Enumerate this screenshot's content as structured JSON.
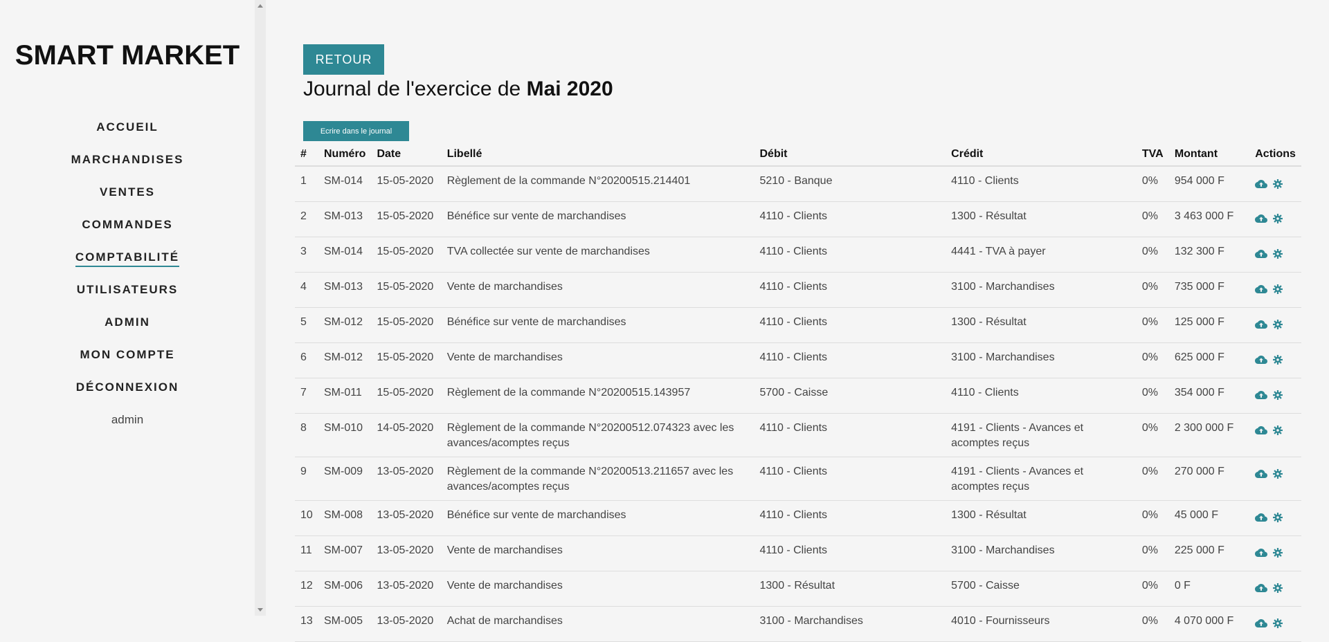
{
  "sidebar": {
    "brand": "SMART MARKET",
    "items": [
      {
        "label": "ACCUEIL",
        "active": false
      },
      {
        "label": "MARCHANDISES",
        "active": false
      },
      {
        "label": "VENTES",
        "active": false
      },
      {
        "label": "COMMANDES",
        "active": false
      },
      {
        "label": "COMPTABILITÉ",
        "active": true
      },
      {
        "label": "UTILISATEURS",
        "active": false
      },
      {
        "label": "ADMIN",
        "active": false
      },
      {
        "label": "MON COMPTE",
        "active": false
      },
      {
        "label": "DÉCONNEXION",
        "active": false
      }
    ],
    "user": "admin"
  },
  "main": {
    "back_label": "RETOUR",
    "title_prefix": "Journal de l'exercice de ",
    "title_period": "Mai 2020",
    "write_label": "Ecrire dans le journal"
  },
  "table": {
    "headers": [
      "#",
      "Numéro",
      "Date",
      "Libellé",
      "Débit",
      "Crédit",
      "TVA",
      "Montant",
      "Actions"
    ],
    "rows": [
      {
        "idx": "1",
        "num": "SM-014",
        "date": "15-05-2020",
        "libelle": "Règlement de la commande N°20200515.214401",
        "debit": "5210 - Banque",
        "credit": "4110 - Clients",
        "tva": "0%",
        "montant": "954 000 F"
      },
      {
        "idx": "2",
        "num": "SM-013",
        "date": "15-05-2020",
        "libelle": "Bénéfice sur vente de marchandises",
        "debit": "4110 - Clients",
        "credit": "1300 - Résultat",
        "tva": "0%",
        "montant": "3 463 000 F"
      },
      {
        "idx": "3",
        "num": "SM-014",
        "date": "15-05-2020",
        "libelle": "TVA collectée sur vente de marchandises",
        "debit": "4110 - Clients",
        "credit": "4441 - TVA à payer",
        "tva": "0%",
        "montant": "132 300 F"
      },
      {
        "idx": "4",
        "num": "SM-013",
        "date": "15-05-2020",
        "libelle": "Vente de marchandises",
        "debit": "4110 - Clients",
        "credit": "3100 - Marchandises",
        "tva": "0%",
        "montant": "735 000 F"
      },
      {
        "idx": "5",
        "num": "SM-012",
        "date": "15-05-2020",
        "libelle": "Bénéfice sur vente de marchandises",
        "debit": "4110 - Clients",
        "credit": "1300 - Résultat",
        "tva": "0%",
        "montant": "125 000 F"
      },
      {
        "idx": "6",
        "num": "SM-012",
        "date": "15-05-2020",
        "libelle": "Vente de marchandises",
        "debit": "4110 - Clients",
        "credit": "3100 - Marchandises",
        "tva": "0%",
        "montant": "625 000 F"
      },
      {
        "idx": "7",
        "num": "SM-011",
        "date": "15-05-2020",
        "libelle": "Règlement de la commande N°20200515.143957",
        "debit": "5700 - Caisse",
        "credit": "4110 - Clients",
        "tva": "0%",
        "montant": "354 000 F"
      },
      {
        "idx": "8",
        "num": "SM-010",
        "date": "14-05-2020",
        "libelle": "Règlement de la commande N°20200512.074323 avec les avances/acomptes reçus",
        "debit": "4110 - Clients",
        "credit": "4191 - Clients - Avances et acomptes reçus",
        "tva": "0%",
        "montant": "2 300 000 F"
      },
      {
        "idx": "9",
        "num": "SM-009",
        "date": "13-05-2020",
        "libelle": "Règlement de la commande N°20200513.211657 avec les avances/acomptes reçus",
        "debit": "4110 - Clients",
        "credit": "4191 - Clients - Avances et acomptes reçus",
        "tva": "0%",
        "montant": "270 000 F"
      },
      {
        "idx": "10",
        "num": "SM-008",
        "date": "13-05-2020",
        "libelle": "Bénéfice sur vente de marchandises",
        "debit": "4110 - Clients",
        "credit": "1300 - Résultat",
        "tva": "0%",
        "montant": "45 000 F"
      },
      {
        "idx": "11",
        "num": "SM-007",
        "date": "13-05-2020",
        "libelle": "Vente de marchandises",
        "debit": "4110 - Clients",
        "credit": "3100 - Marchandises",
        "tva": "0%",
        "montant": "225 000 F"
      },
      {
        "idx": "12",
        "num": "SM-006",
        "date": "13-05-2020",
        "libelle": "Vente de marchandises",
        "debit": "1300 - Résultat",
        "credit": "5700 - Caisse",
        "tva": "0%",
        "montant": "0 F"
      },
      {
        "idx": "13",
        "num": "SM-005",
        "date": "13-05-2020",
        "libelle": "Achat de marchandises",
        "debit": "3100 - Marchandises",
        "credit": "4010 - Fournisseurs",
        "tva": "0%",
        "montant": "4 070 000 F"
      }
    ],
    "action_icons": [
      "upload-cloud-icon",
      "gear-icon"
    ]
  },
  "colors": {
    "accent": "#2e8894",
    "background": "#f5f5f5",
    "border": "#dddddd"
  }
}
